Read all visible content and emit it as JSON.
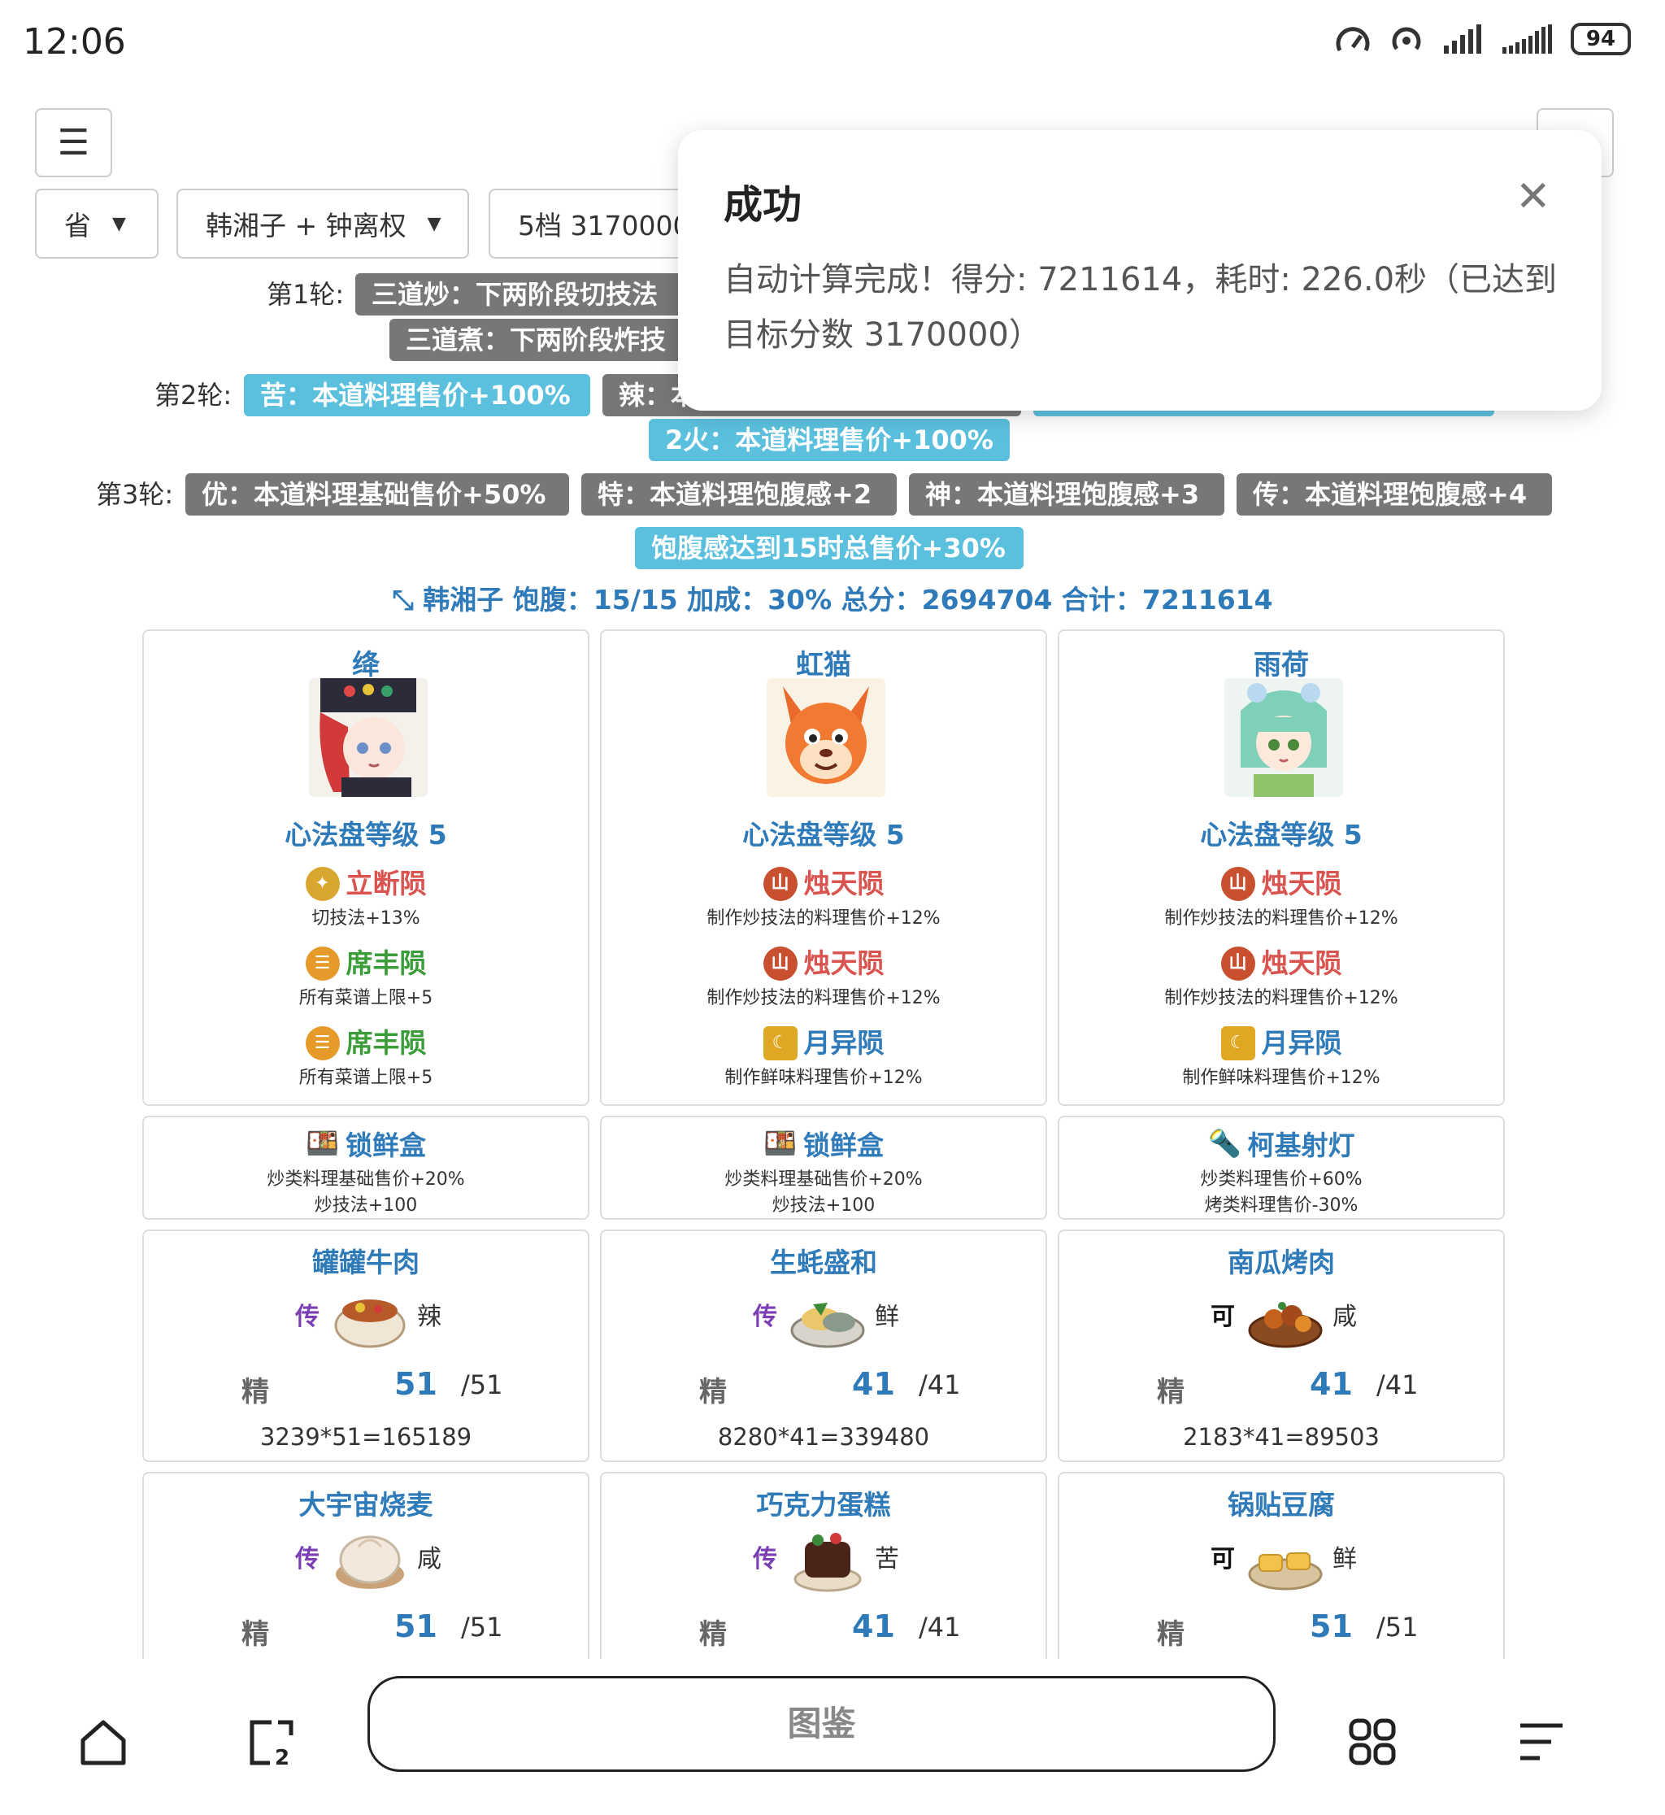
{
  "status": {
    "time": "12:06",
    "battery": "94"
  },
  "toolbar": {
    "menu_icon": "hamburger-icon",
    "settings_icon": "gear-icon"
  },
  "filters": {
    "region": "省",
    "chefs": "韩湘子 + 钟离权",
    "target": "5档 3170000"
  },
  "rounds": {
    "r1_label": "第1轮:",
    "r1_tags": [
      "三道炒：下两阶段切技法",
      "三道煮：下两阶段炸技"
    ],
    "r2_label": "第2轮:",
    "r2_tags": [
      "苦：本道料理售价+100%",
      "辣：本",
      "2火：本道料理售价+100%"
    ],
    "r3_label": "第3轮:",
    "r3_tags": [
      "优：本道料理基础售价+50%",
      "特：本道料理饱腹感+2",
      "神：本道料理饱腹感+3",
      "传：本道料理饱腹感+4",
      "饱腹感达到15时总售价+30%"
    ]
  },
  "summary": "韩湘子 饱腹：15/15 加成：30% 总分：2694704 合计：7211614",
  "chefs": [
    {
      "name": "绛",
      "level": "心法盘等级 5",
      "disks": [
        {
          "name": "立断陨",
          "desc": "切技法+13%"
        },
        {
          "name": "席丰陨",
          "desc": "所有菜谱上限+5"
        },
        {
          "name": "席丰陨",
          "desc": "所有菜谱上限+5"
        }
      ],
      "equip": {
        "name": "锁鲜盒",
        "desc1": "炒类料理基础售价+20%",
        "desc2": "炒技法+100"
      }
    },
    {
      "name": "虹猫",
      "level": "心法盘等级 5",
      "disks": [
        {
          "name": "烛天陨",
          "desc": "制作炒技法的料理售价+12%"
        },
        {
          "name": "烛天陨",
          "desc": "制作炒技法的料理售价+12%"
        },
        {
          "name": "月异陨",
          "desc": "制作鲜味料理售价+12%"
        }
      ],
      "equip": {
        "name": "锁鲜盒",
        "desc1": "炒类料理基础售价+20%",
        "desc2": "炒技法+100"
      }
    },
    {
      "name": "雨荷",
      "level": "心法盘等级 5",
      "disks": [
        {
          "name": "烛天陨",
          "desc": "制作炒技法的料理售价+12%"
        },
        {
          "name": "烛天陨",
          "desc": "制作炒技法的料理售价+12%"
        },
        {
          "name": "月异陨",
          "desc": "制作鲜味料理售价+12%"
        }
      ],
      "equip": {
        "name": "柯基射灯",
        "desc1": "炒类料理售价+60%",
        "desc2": "烤类料理售价-30%"
      }
    }
  ],
  "dishes_row1": [
    {
      "name": "罐罐牛肉",
      "rarity": "传",
      "flavor": "辣",
      "grade": "精",
      "qty": "51",
      "max": "/51",
      "formula": "3239*51=165189"
    },
    {
      "name": "生蚝盛和",
      "rarity": "传",
      "flavor": "鲜",
      "grade": "精",
      "qty": "41",
      "max": "/41",
      "formula": "8280*41=339480"
    },
    {
      "name": "南瓜烤肉",
      "rarity": "可",
      "flavor": "咸",
      "grade": "精",
      "qty": "41",
      "max": "/41",
      "formula": "2183*41=89503"
    }
  ],
  "dishes_row2": [
    {
      "name": "大宇宙烧麦",
      "rarity": "传",
      "flavor": "咸",
      "grade": "精",
      "qty": "51",
      "max": "/51"
    },
    {
      "name": "巧克力蛋糕",
      "rarity": "传",
      "flavor": "苦",
      "grade": "精",
      "qty": "41",
      "max": "/41"
    },
    {
      "name": "锅贴豆腐",
      "rarity": "可",
      "flavor": "鲜",
      "grade": "精",
      "qty": "51",
      "max": "/51"
    }
  ],
  "toast": {
    "title": "成功",
    "message": "自动计算完成！得分: 7211614，耗时: 226.0秒（已达到目标分数 3170000）"
  },
  "bottom_nav": {
    "url_label": "图鉴"
  },
  "colors": {
    "gray_tag": "#777777",
    "blue_tag": "#5bc0de",
    "accent": "#2f7ab8"
  }
}
